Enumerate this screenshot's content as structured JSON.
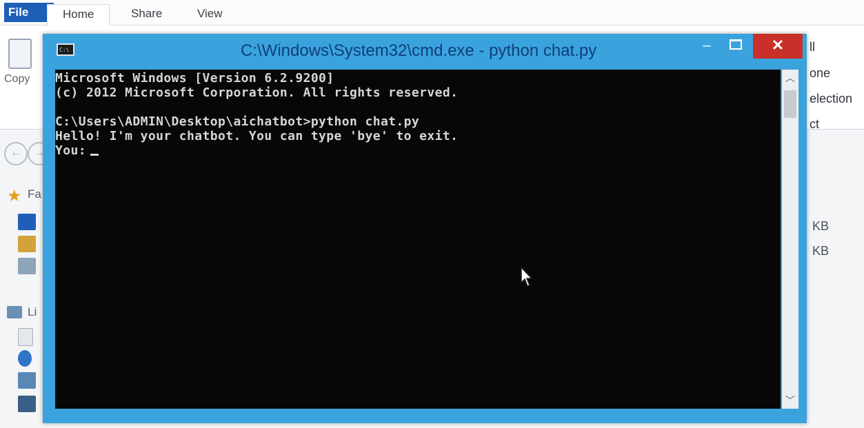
{
  "explorer": {
    "tabs": [
      "File",
      "Home",
      "Share",
      "View"
    ],
    "copy_label": "Copy",
    "ribbon_right_labels": [
      "ll",
      "one",
      "election",
      "ct"
    ],
    "favorites_label": "Fa",
    "libraries_label": "Li",
    "size_values": [
      "KB",
      "KB"
    ]
  },
  "cmd": {
    "title": "C:\\Windows\\System32\\cmd.exe - python  chat.py",
    "icon_text": "C:\\",
    "controls": {
      "minimize": "–",
      "close": "✕"
    },
    "lines": [
      "Microsoft Windows [Version 6.2.9200]",
      "(c) 2012 Microsoft Corporation. All rights reserved.",
      "",
      "C:\\Users\\ADMIN\\Desktop\\aichatbot>python chat.py",
      "Hello! I'm your chatbot. You can type 'bye' to exit.",
      "You:"
    ]
  },
  "colors": {
    "window_frame": "#3aa3de",
    "title_text": "#0f3f79",
    "close_button": "#c9302a",
    "console_bg": "#070707",
    "console_text": "#d6d6d6",
    "file_tab": "#1d5fb6"
  }
}
